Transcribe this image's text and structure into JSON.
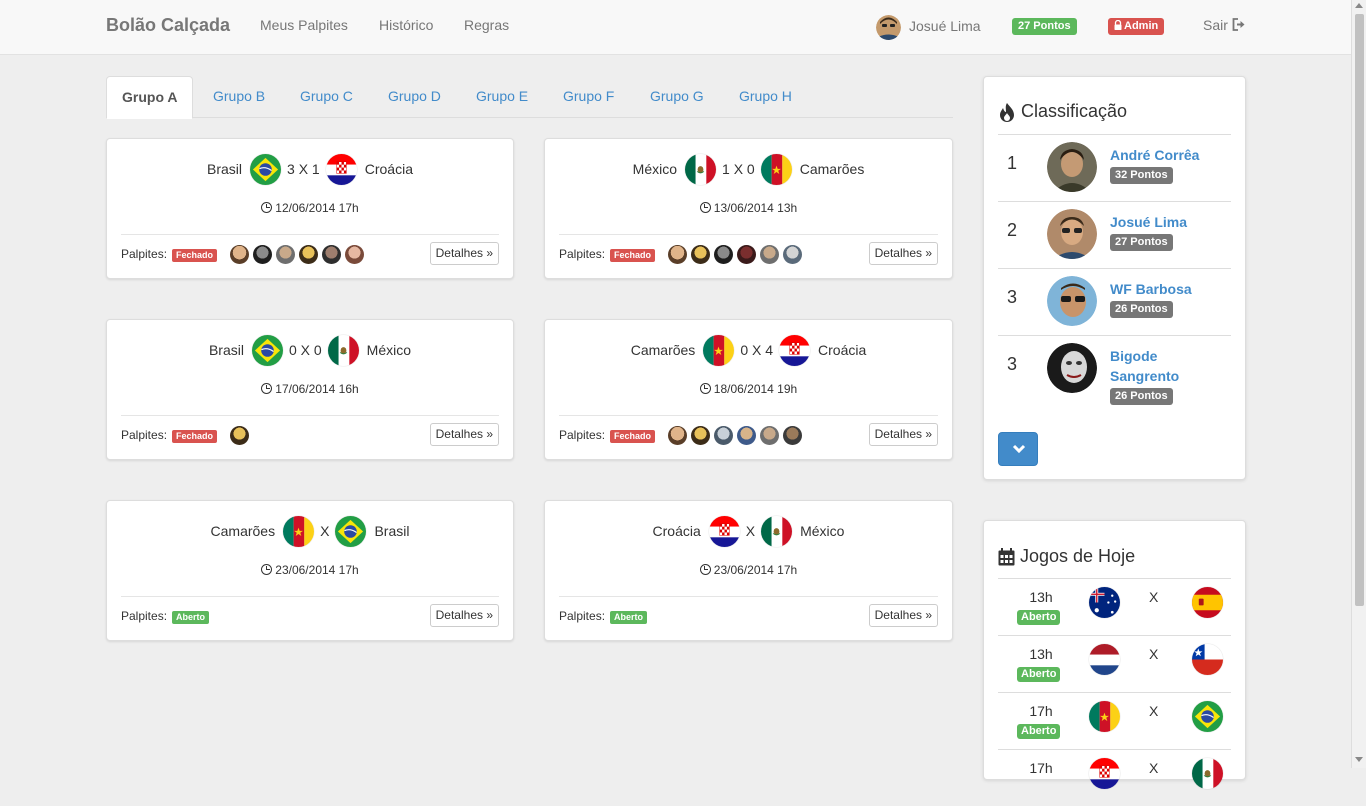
{
  "navbar": {
    "brand": "Bolão Calçada",
    "links": [
      "Meus Palpites",
      "Histórico",
      "Regras"
    ],
    "user_name": "Josué Lima",
    "points_badge": "27 Pontos",
    "admin_badge": "Admin",
    "logout": "Sair"
  },
  "tabs": [
    "Grupo A",
    "Grupo B",
    "Grupo C",
    "Grupo D",
    "Grupo E",
    "Grupo F",
    "Grupo G",
    "Grupo H"
  ],
  "active_tab": "Grupo A",
  "matches": [
    {
      "home": "Brasil",
      "away": "Croácia",
      "score": "3 X 1",
      "date": "12/06/2014 17h",
      "palpites_label": "Palpites:",
      "status": "Fechado",
      "details": "Detalhes »"
    },
    {
      "home": "México",
      "away": "Camarões",
      "score": "1 X 0",
      "date": "13/06/2014 13h",
      "palpites_label": "Palpites:",
      "status": "Fechado",
      "details": "Detalhes »"
    },
    {
      "home": "Brasil",
      "away": "México",
      "score": "0 X 0",
      "date": "17/06/2014 16h",
      "palpites_label": "Palpites:",
      "status": "Fechado",
      "details": "Detalhes »"
    },
    {
      "home": "Camarões",
      "away": "Croácia",
      "score": "0 X 4",
      "date": "18/06/2014 19h",
      "palpites_label": "Palpites:",
      "status": "Fechado",
      "details": "Detalhes »"
    },
    {
      "home": "Camarões",
      "away": "Brasil",
      "score": "X",
      "date": "23/06/2014 17h",
      "palpites_label": "Palpites:",
      "status": "Aberto",
      "details": "Detalhes »"
    },
    {
      "home": "Croácia",
      "away": "México",
      "score": "X",
      "date": "23/06/2014 17h",
      "palpites_label": "Palpites:",
      "status": "Aberto",
      "details": "Detalhes »"
    }
  ],
  "ranking": {
    "title": "Classificação",
    "rows": [
      {
        "position": "1",
        "name": "André Corrêa",
        "points": "32 Pontos"
      },
      {
        "position": "2",
        "name": "Josué Lima",
        "points": "27 Pontos"
      },
      {
        "position": "3",
        "name": "WF Barbosa",
        "points": "26 Pontos"
      },
      {
        "position": "3",
        "name": "Bigode Sangrento",
        "points": "26 Pontos"
      }
    ]
  },
  "today_games": {
    "title": "Jogos de Hoje",
    "rows": [
      {
        "time": "13h",
        "status": "Aberto",
        "x": "X",
        "flag_a": "australia-flag",
        "flag_b": "spain-flag"
      },
      {
        "time": "13h",
        "status": "Aberto",
        "x": "X",
        "flag_a": "netherlands-flag",
        "flag_b": "chile-flag"
      },
      {
        "time": "17h",
        "status": "Aberto",
        "x": "X",
        "flag_a": "cameroon-flag",
        "flag_b": "brazil-flag"
      },
      {
        "time": "17h",
        "status": "",
        "x": "X",
        "flag_a": "croatia-flag",
        "flag_b": "mexico-flag"
      }
    ]
  },
  "colors": {
    "link": "#428bca",
    "success": "#5cb85c",
    "danger": "#d9534f",
    "default_badge": "#777777"
  }
}
